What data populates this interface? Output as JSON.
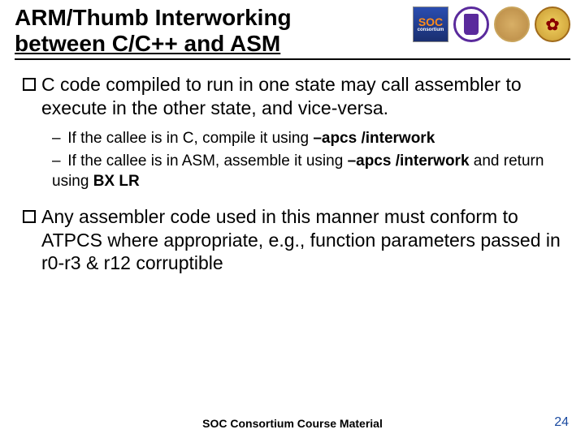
{
  "title_line1": "ARM/Thumb Interworking",
  "title_line2": "between C/C++ and ASM",
  "bullets": [
    {
      "text": "C code compiled to run in one state may call assembler to execute in the other state, and vice-versa.",
      "subs": [
        {
          "prefix": "If the callee is in C, compile it using ",
          "bold1": "–apcs /interwork",
          "mid": "",
          "bold2": "",
          "suffix": ""
        },
        {
          "prefix": "If the callee is in ASM, assemble it using ",
          "bold1": "–apcs /interwork",
          "mid": " and return using ",
          "bold2": "BX LR",
          "suffix": ""
        }
      ]
    },
    {
      "text": "Any assembler code used in this manner must conform to ATPCS where appropriate, e.g., function parameters passed in r0-r3 & r12 corruptible",
      "subs": []
    }
  ],
  "footer": "SOC Consortium Course Material",
  "page": "24",
  "soc_label_top": "SOC",
  "soc_label_bot": "consortium"
}
